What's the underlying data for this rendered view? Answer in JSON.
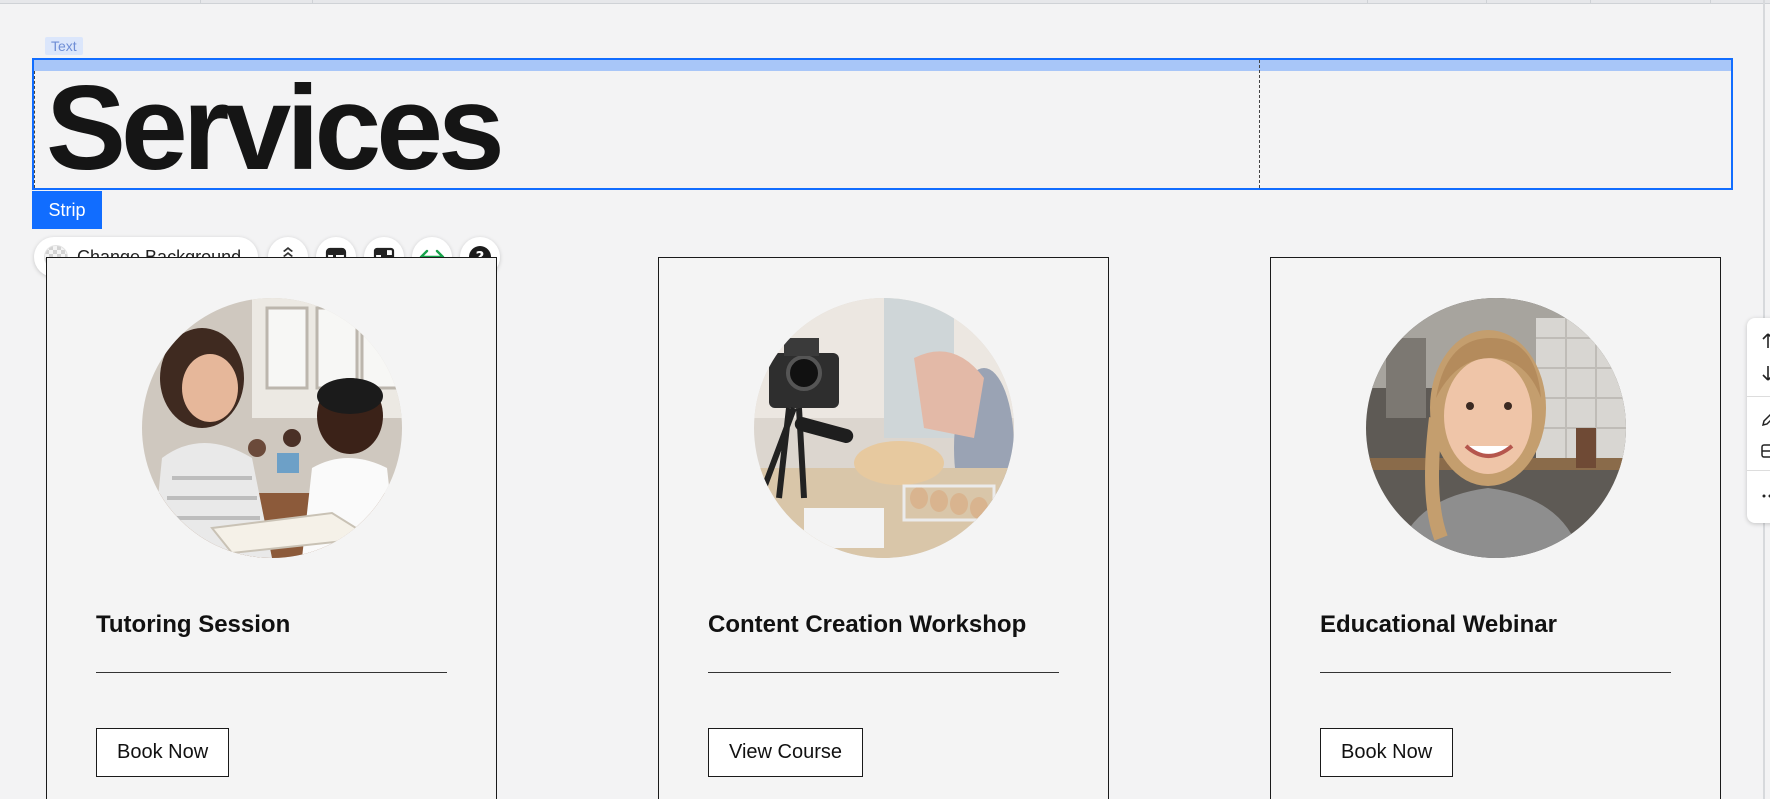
{
  "editor": {
    "text_tag": "Text",
    "strip_tag": "Strip",
    "toolbar": {
      "change_background_label": "Change Background",
      "icons": [
        "layers-arrange-icon",
        "layout-icon",
        "crop-icon",
        "stretch-icon",
        "help-icon"
      ]
    },
    "accent_color": "#116dff"
  },
  "page": {
    "title": "Services"
  },
  "cards": [
    {
      "title": "Tutoring Session",
      "button": "Book Now",
      "image": "teacher-with-student-photo"
    },
    {
      "title": "Content Creation Workshop",
      "button": "View Course",
      "image": "camera-filming-baking-photo"
    },
    {
      "title": "Educational Webinar",
      "button": "Book Now",
      "image": "smiling-woman-kitchen-photo"
    }
  ],
  "side_panel": {
    "icons": [
      "move-up-icon",
      "move-down-icon",
      "edit-icon",
      "layout-icon",
      "more-icon"
    ]
  }
}
